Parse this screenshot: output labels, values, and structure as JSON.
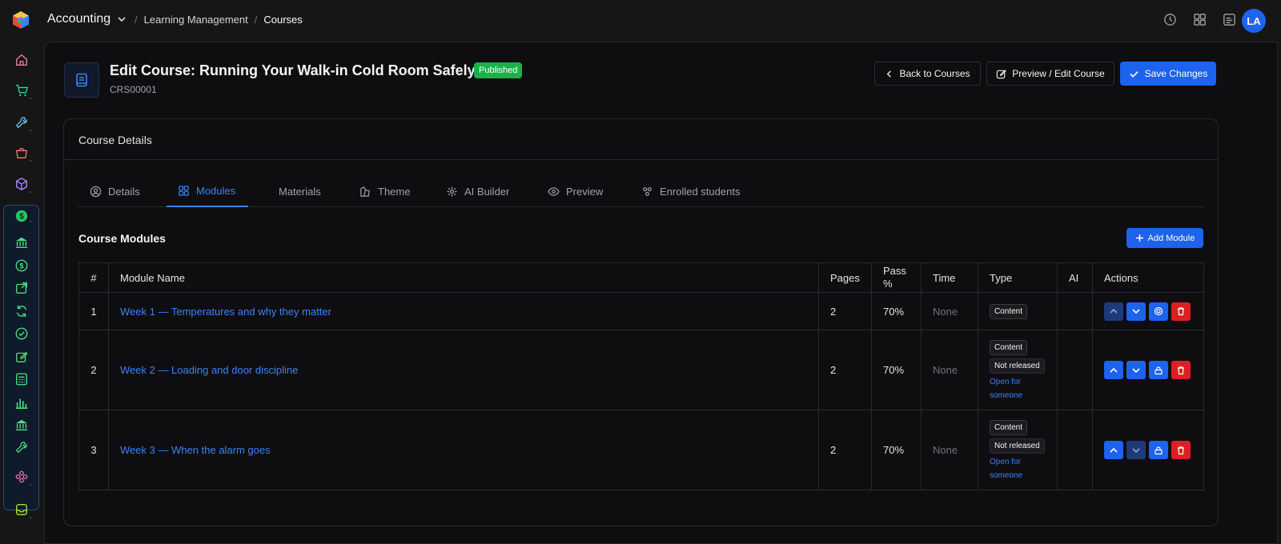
{
  "topbar": {
    "app_name": "Accounting",
    "breadcrumbs": [
      "Learning Management",
      "Courses"
    ],
    "avatar": "LA",
    "icons": [
      "clock-icon",
      "grid-icon",
      "notes-icon"
    ]
  },
  "sidebar": {
    "items": [
      "home-icon",
      "cart-icon",
      "wrench-icon",
      "basket-icon",
      "box-icon",
      "dollar-icon"
    ],
    "group_items": [
      "bank-icon",
      "dollar-circle-icon",
      "export-icon",
      "refresh-icon",
      "check-circle-icon",
      "edit-icon",
      "calculator-icon",
      "bar-chart-icon",
      "bank-icon",
      "wrench-icon"
    ],
    "bottom_items": [
      "flower-icon",
      "inbox-icon"
    ]
  },
  "header": {
    "title": "Edit Course: Running Your Walk-in Cold Room Safely",
    "status": "Published",
    "code": "CRS00001",
    "back_label": "Back to Courses",
    "preview_label": "Preview / Edit Course",
    "save_label": "Save Changes"
  },
  "card": {
    "title": "Course Details",
    "tabs": [
      {
        "label": "Details",
        "icon": "user-circle-icon"
      },
      {
        "label": "Modules",
        "icon": "grid-icon"
      },
      {
        "label": "Materials",
        "icon": "book-icon"
      },
      {
        "label": "Theme",
        "icon": "palette-icon"
      },
      {
        "label": "AI Builder",
        "icon": "sparkle-icon"
      },
      {
        "label": "Preview",
        "icon": "eye-icon"
      },
      {
        "label": "Enrolled students",
        "icon": "users-icon"
      }
    ],
    "active_tab": "Modules"
  },
  "modules": {
    "title": "Course Modules",
    "add_label": "Add Module",
    "columns": [
      "#",
      "Module Name",
      "Pages",
      "Pass %",
      "Time",
      "Type",
      "AI",
      "Actions"
    ],
    "rows": [
      {
        "num": "1",
        "name": "Week 1 — Temperatures and why they matter",
        "pages": "2",
        "pass": "70%",
        "time": "None",
        "type": "Content",
        "released": "",
        "open_for": ""
      },
      {
        "num": "2",
        "name": "Week 2 — Loading and door discipline",
        "pages": "2",
        "pass": "70%",
        "time": "None",
        "type": "Content",
        "released": "Not released",
        "open_for": "Open for someone"
      },
      {
        "num": "3",
        "name": "Week 3 — When the alarm goes",
        "pages": "2",
        "pass": "70%",
        "time": "None",
        "type": "Content",
        "released": "Not released",
        "open_for": "Open for someone"
      }
    ]
  },
  "colors": {
    "accent": "#1d63ed",
    "link": "#3b82f6",
    "published": "#16b34a",
    "danger": "#dc1f26",
    "background": "#0e0e10"
  }
}
